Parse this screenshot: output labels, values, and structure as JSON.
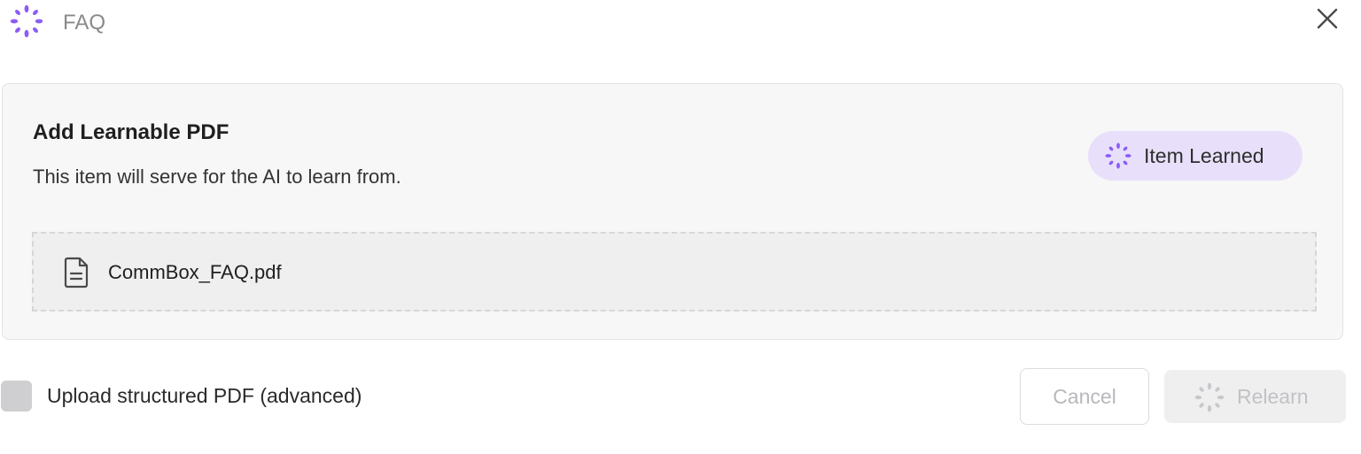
{
  "header": {
    "title": "FAQ",
    "icon": "sparkle-icon",
    "close_icon": "close-icon"
  },
  "card": {
    "title": "Add Learnable PDF",
    "subtitle": "This item will serve for the AI to learn from.",
    "badge": {
      "label": "Item Learned",
      "icon": "sparkle-icon"
    },
    "file": {
      "name": "CommBox_FAQ.pdf",
      "icon": "document-icon"
    }
  },
  "footer": {
    "checkbox_label": "Upload structured PDF (advanced)",
    "checkbox_checked": false,
    "cancel_label": "Cancel",
    "relearn_label": "Relearn",
    "relearn_icon": "sparkle-icon"
  },
  "colors": {
    "accent": "#8b5cf6",
    "badge_background": "#e8e0fa",
    "disabled_text": "#c2c2c6"
  }
}
